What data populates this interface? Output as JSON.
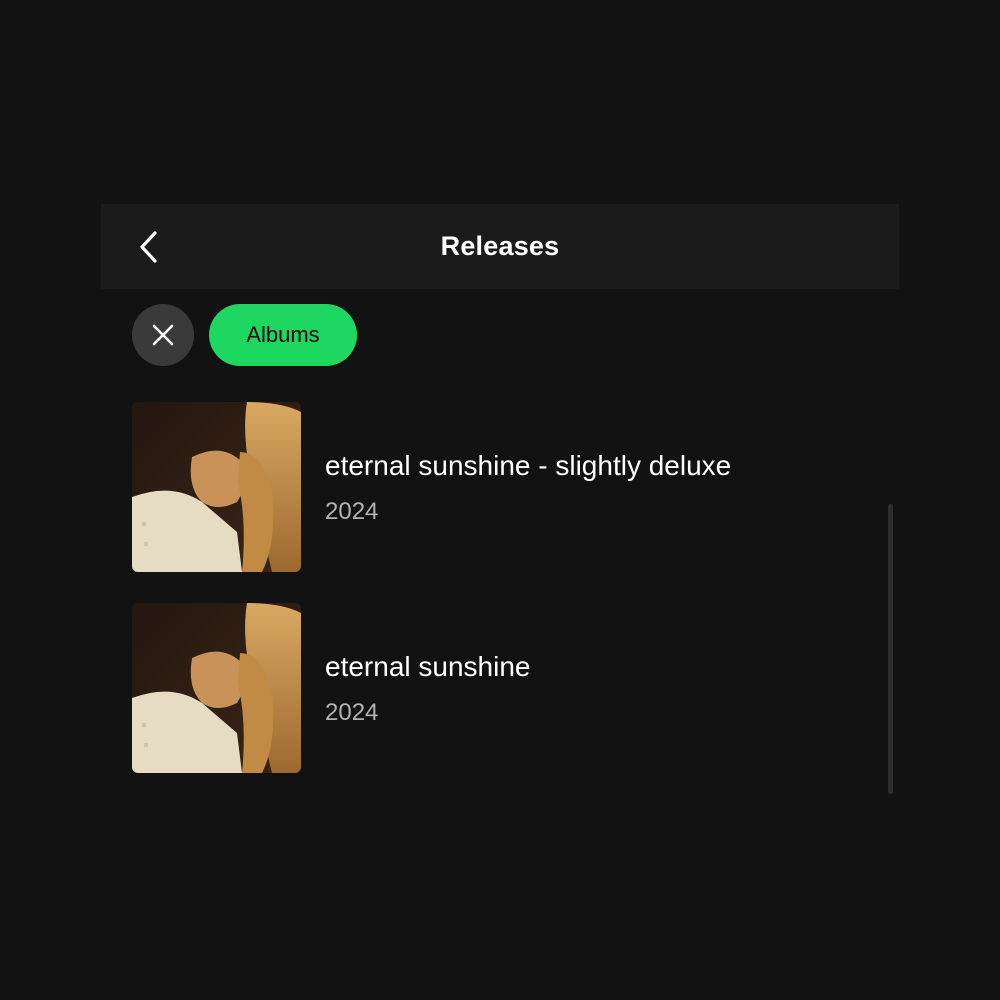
{
  "header": {
    "title": "Releases",
    "back_icon": "chevron-left-icon"
  },
  "filters": {
    "clear_icon": "close-icon",
    "active_chip": "Albums",
    "accent_color": "#1ed760"
  },
  "releases": [
    {
      "title": "eternal sunshine - slightly deluxe",
      "year": "2024"
    },
    {
      "title": "eternal sunshine",
      "year": "2024"
    }
  ]
}
